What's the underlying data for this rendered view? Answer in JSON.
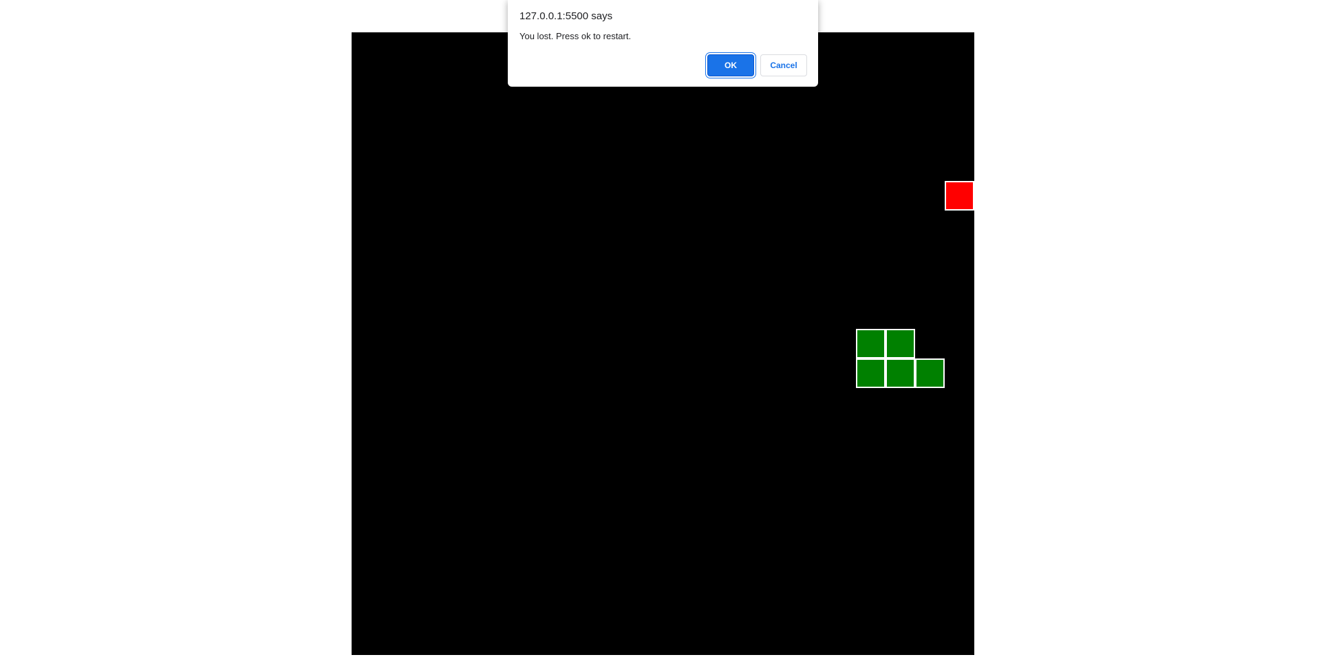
{
  "dialog": {
    "origin": "127.0.0.1:5500 says",
    "message": "You lost. Press ok to restart.",
    "ok_label": "OK",
    "cancel_label": "Cancel"
  },
  "game": {
    "board_color": "#000000",
    "snake_color": "#008000",
    "food_color": "#ff0000",
    "cell_border_color": "#ffffff",
    "grid_size": 21,
    "food": {
      "col": 20,
      "row": 5
    },
    "snake": [
      {
        "col": 17,
        "row": 10
      },
      {
        "col": 18,
        "row": 10
      },
      {
        "col": 17,
        "row": 11
      },
      {
        "col": 18,
        "row": 11
      },
      {
        "col": 19,
        "row": 11
      }
    ]
  }
}
